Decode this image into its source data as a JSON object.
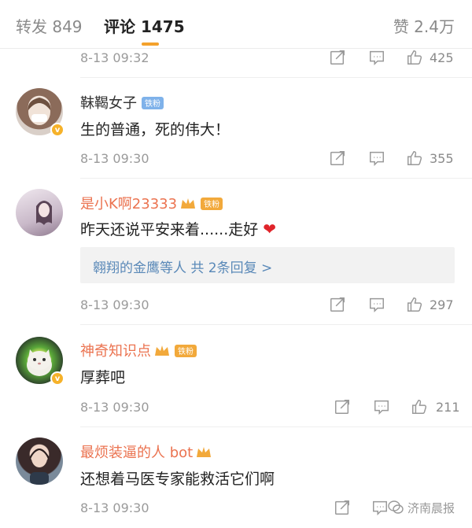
{
  "tabs": {
    "repost": "转发 849",
    "comment": "评论 1475",
    "like": "赞 2.4万"
  },
  "colors": {
    "accent": "#f4a12c",
    "username_highlight": "#eb7350",
    "link": "#5a89b8"
  },
  "comments": [
    {
      "time": "8-13 09:32",
      "likes": "425"
    },
    {
      "user": "靺鞨女子",
      "fan_badge": "铁粉",
      "text": "生的普通，死的伟大！",
      "time": "8-13 09:30",
      "likes": "355",
      "avatar_icon": "woman-with-mask-avatar"
    },
    {
      "user": "是小K啊23333",
      "fan_badge": "铁粉",
      "text": "昨天还说平安来着......走好",
      "time": "8-13 09:30",
      "likes": "297",
      "reply_summary": "翱翔的金鹰等人  共 2条回复 >",
      "avatar_icon": "girl-avatar"
    },
    {
      "user": "神奇知识点",
      "fan_badge": "铁粉",
      "text": "厚葬吧",
      "time": "8-13 09:30",
      "likes": "211",
      "avatar_icon": "cat-avatar"
    },
    {
      "user": "最烦装逼的人 bot",
      "text": "还想着马医专家能救活它们啊",
      "time": "8-13 09:30",
      "avatar_icon": "woman-portrait-avatar"
    }
  ],
  "watermark": "济南晨报",
  "icons": {
    "share": "share-icon",
    "reply": "comment-icon",
    "like": "thumbs-up-icon"
  }
}
